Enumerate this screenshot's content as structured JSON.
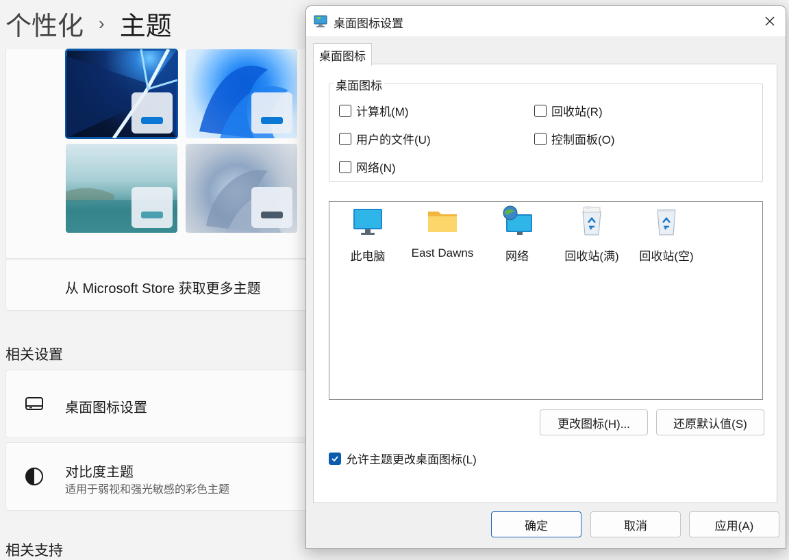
{
  "settings": {
    "breadcrumb": {
      "parent": "个性化",
      "separator": "›",
      "current": "主题"
    },
    "store_link": "从 Microsoft Store 获取更多主题",
    "related_heading": "相关设置",
    "rows": {
      "desktop_icons": {
        "title": "桌面图标设置"
      },
      "contrast": {
        "title": "对比度主题",
        "subtitle": "适用于弱视和强光敏感的彩色主题"
      }
    },
    "cut_off_text": "相关支持"
  },
  "dialog": {
    "title": "桌面图标设置",
    "tab_label": "桌面图标",
    "group_title": "桌面图标",
    "checkboxes": {
      "computer": {
        "label": "计算机(M)",
        "checked": false
      },
      "recycle_bin": {
        "label": "回收站(R)",
        "checked": false
      },
      "user_files": {
        "label": "用户的文件(U)",
        "checked": false
      },
      "control_panel": {
        "label": "控制面板(O)",
        "checked": false
      },
      "network": {
        "label": "网络(N)",
        "checked": false
      }
    },
    "icons": [
      {
        "label": "此电脑",
        "icon": "monitor-icon"
      },
      {
        "label": "East Dawns",
        "icon": "folder-icon"
      },
      {
        "label": "网络",
        "icon": "network-globe-icon"
      },
      {
        "label": "回收站(满)",
        "icon": "recycle-bin-full-icon"
      },
      {
        "label": "回收站(空)",
        "icon": "recycle-bin-empty-icon"
      }
    ],
    "change_icon_button": "更改图标(H)...",
    "restore_default_button": "还原默认值(S)",
    "allow_themes": {
      "label": "允许主题更改桌面图标(L)",
      "checked": true
    },
    "ok_button": "确定",
    "cancel_button": "取消",
    "apply_button": "应用(A)"
  },
  "colors": {
    "accent": "#0b5cad",
    "selected_outline": "#0f5aa8"
  }
}
